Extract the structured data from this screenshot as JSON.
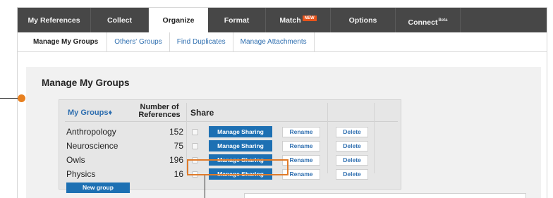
{
  "topnav": {
    "tabs": [
      {
        "label": "My References"
      },
      {
        "label": "Collect"
      },
      {
        "label": "Organize"
      },
      {
        "label": "Format"
      },
      {
        "label": "Match",
        "badge": "NEW"
      },
      {
        "label": "Options"
      },
      {
        "label": "Connect",
        "sup": "Beta"
      }
    ],
    "active": "Organize"
  },
  "subnav": {
    "tabs": [
      {
        "label": "Manage My Groups"
      },
      {
        "label": "Others' Groups"
      },
      {
        "label": "Find Duplicates"
      },
      {
        "label": "Manage Attachments"
      }
    ],
    "active": "Manage My Groups"
  },
  "page": {
    "title": "Manage My Groups"
  },
  "table": {
    "col_groups": "My Groups♦",
    "col_num_line1": "Number of",
    "col_num_line2": "References",
    "col_share": "Share",
    "rows": [
      {
        "name": "Anthropology",
        "count": "152",
        "share_label": "Manage Sharing",
        "rename_label": "Rename",
        "delete_label": "Delete"
      },
      {
        "name": "Neuroscience",
        "count": "75",
        "share_label": "Manage Sharing",
        "rename_label": "Rename",
        "delete_label": "Delete"
      },
      {
        "name": "Owls",
        "count": "196",
        "share_label": "Manage Sharing",
        "rename_label": "Rename",
        "delete_label": "Delete"
      },
      {
        "name": "Physics",
        "count": "16",
        "share_label": "Manage Sharing",
        "rename_label": "Rename",
        "delete_label": "Delete"
      }
    ],
    "new_group_label": "New group"
  },
  "colors": {
    "nav_bg": "#474747",
    "accent_blue": "#1d70b3",
    "link_blue": "#2f6fb0",
    "highlight_orange": "#e07b2a",
    "new_badge": "#e8531a"
  }
}
